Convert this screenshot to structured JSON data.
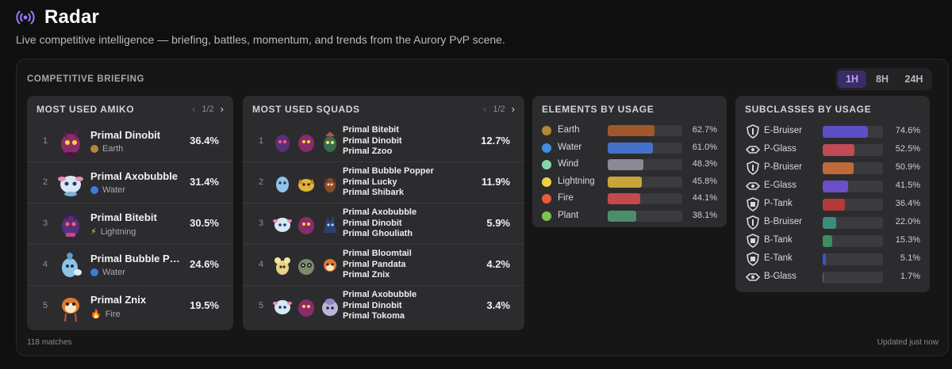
{
  "header": {
    "title": "Radar",
    "subtitle": "Live competitive intelligence — briefing, battles, momentum, and trends from the Aurory PvP scene."
  },
  "briefing": {
    "title": "COMPETITIVE BRIEFING",
    "timeframes": [
      "1H",
      "8H",
      "24H"
    ],
    "active_timeframe": "1H",
    "footer_matches": "118 matches",
    "footer_updated": "Updated just now"
  },
  "amiko": {
    "title": "MOST USED AMIKO",
    "page": "1/2",
    "items": [
      {
        "rank": "1",
        "name": "Primal Dinobit",
        "element": "Earth",
        "element_color": "#b07a2a",
        "pct": "36.4%",
        "sprite": "dinobit-sprite"
      },
      {
        "rank": "2",
        "name": "Primal Axobubble",
        "element": "Water",
        "element_color": "#3d7bd9",
        "pct": "31.4%",
        "sprite": "axobubble-sprite"
      },
      {
        "rank": "3",
        "name": "Primal Bitebit",
        "element": "Lightning",
        "element_color": "#e6c23a",
        "pct": "30.5%",
        "sprite": "bitebit-sprite"
      },
      {
        "rank": "4",
        "name": "Primal Bubble Popper",
        "element": "Water",
        "element_color": "#3d7bd9",
        "pct": "24.6%",
        "sprite": "bubble-popper-sprite"
      },
      {
        "rank": "5",
        "name": "Primal Znix",
        "element": "Fire",
        "element_color": "#e0553a",
        "pct": "19.5%",
        "sprite": "znix-sprite"
      }
    ]
  },
  "squads": {
    "title": "MOST USED SQUADS",
    "page": "1/2",
    "items": [
      {
        "rank": "1",
        "members": [
          "Primal Bitebit",
          "Primal Dinobit",
          "Primal Zzoo"
        ],
        "pct": "12.7%"
      },
      {
        "rank": "2",
        "members": [
          "Primal Bubble Popper",
          "Primal Lucky",
          "Primal Shibark"
        ],
        "pct": "11.9%"
      },
      {
        "rank": "3",
        "members": [
          "Primal Axobubble",
          "Primal Dinobit",
          "Primal Ghouliath"
        ],
        "pct": "5.9%"
      },
      {
        "rank": "4",
        "members": [
          "Primal Bloomtail",
          "Primal Pandata",
          "Primal Znix"
        ],
        "pct": "4.2%"
      },
      {
        "rank": "5",
        "members": [
          "Primal Axobubble",
          "Primal Dinobit",
          "Primal Tokoma"
        ],
        "pct": "3.4%"
      }
    ]
  },
  "elements": {
    "title": "ELEMENTS BY USAGE",
    "items": [
      {
        "label": "Earth",
        "pct": "62.7%",
        "value": 62.7,
        "color": "#a0582b",
        "icon": "earth-icon",
        "icon_color": "#b0893a"
      },
      {
        "label": "Water",
        "pct": "61.0%",
        "value": 61.0,
        "color": "#4470c9",
        "icon": "water-icon",
        "icon_color": "#3f8de0"
      },
      {
        "label": "Wind",
        "pct": "48.3%",
        "value": 48.3,
        "color": "#8a8a94",
        "icon": "wind-icon",
        "icon_color": "#86d7a8"
      },
      {
        "label": "Lightning",
        "pct": "45.8%",
        "value": 45.8,
        "color": "#c9a437",
        "icon": "lightning-icon",
        "icon_color": "#f1d04a"
      },
      {
        "label": "Fire",
        "pct": "44.1%",
        "value": 44.1,
        "color": "#c24a4a",
        "icon": "fire-icon",
        "icon_color": "#ea5a3c"
      },
      {
        "label": "Plant",
        "pct": "38.1%",
        "value": 38.1,
        "color": "#4d8d6b",
        "icon": "plant-icon",
        "icon_color": "#7cc44e"
      }
    ]
  },
  "subclasses": {
    "title": "SUBCLASSES BY USAGE",
    "items": [
      {
        "label": "E-Bruiser",
        "pct": "74.6%",
        "value": 74.6,
        "color": "#5d4fc4",
        "icon": "shield-icon"
      },
      {
        "label": "P-Glass",
        "pct": "52.5%",
        "value": 52.5,
        "color": "#c24a55",
        "icon": "glass-icon"
      },
      {
        "label": "P-Bruiser",
        "pct": "50.9%",
        "value": 50.9,
        "color": "#c06a3a",
        "icon": "shield-icon"
      },
      {
        "label": "E-Glass",
        "pct": "41.5%",
        "value": 41.5,
        "color": "#6a4fc8",
        "icon": "glass-icon"
      },
      {
        "label": "P-Tank",
        "pct": "36.4%",
        "value": 36.4,
        "color": "#b23a3a",
        "icon": "tank-icon"
      },
      {
        "label": "B-Bruiser",
        "pct": "22.0%",
        "value": 22.0,
        "color": "#3f8b7c",
        "icon": "shield-icon"
      },
      {
        "label": "B-Tank",
        "pct": "15.3%",
        "value": 15.3,
        "color": "#3f8b62",
        "icon": "tank-icon"
      },
      {
        "label": "E-Tank",
        "pct": "5.1%",
        "value": 5.1,
        "color": "#3b56c9",
        "icon": "tank-icon"
      },
      {
        "label": "B-Glass",
        "pct": "1.7%",
        "value": 1.7,
        "color": "#3f7d86",
        "icon": "glass-icon"
      }
    ]
  }
}
